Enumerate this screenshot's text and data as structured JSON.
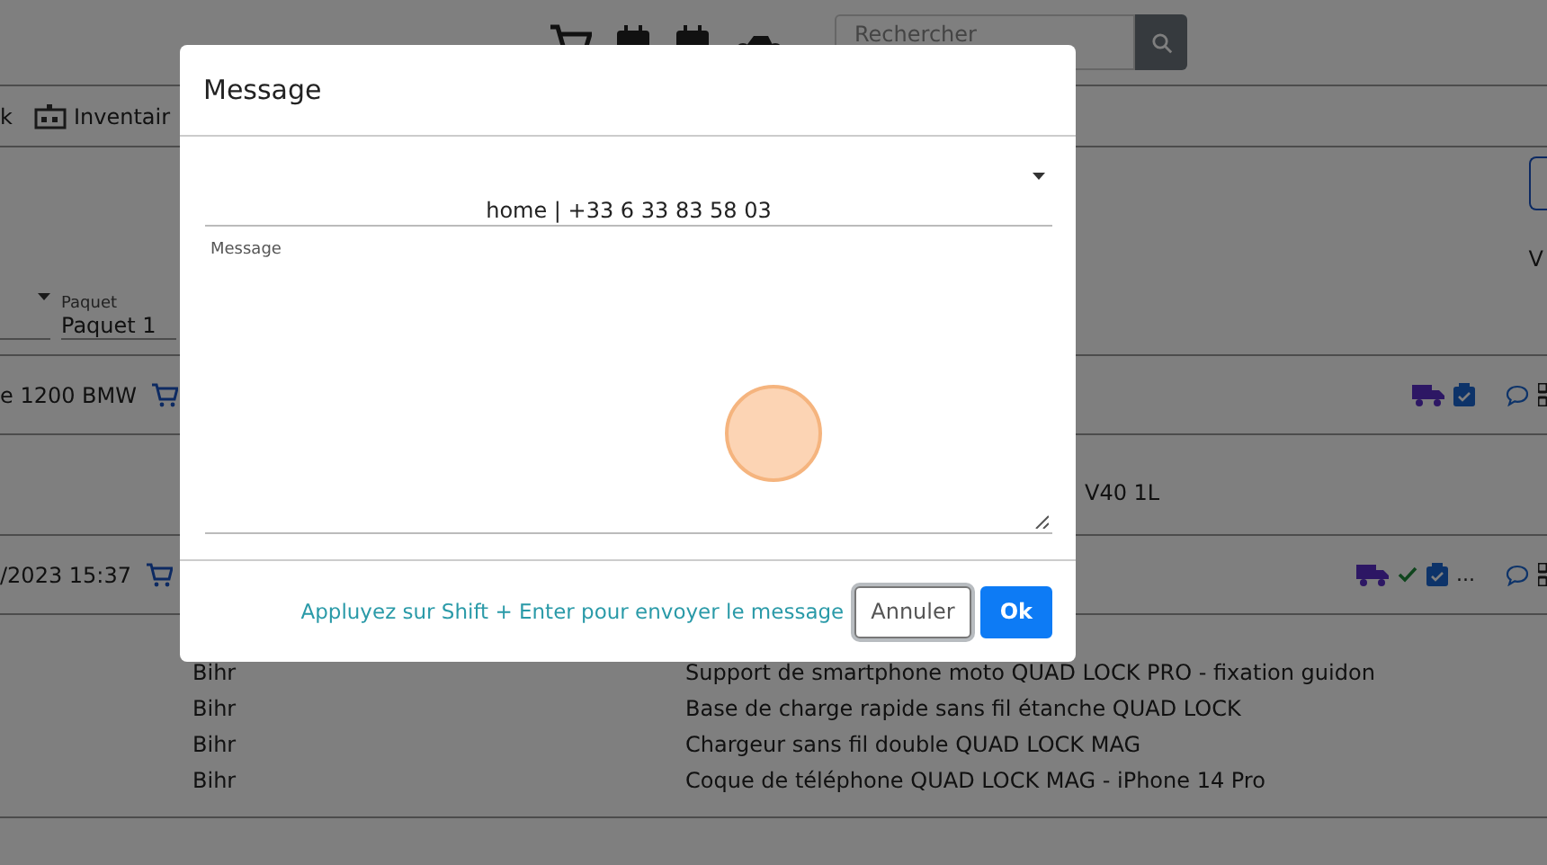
{
  "top_bar": {
    "search": {
      "placeholder": "Rechercher"
    }
  },
  "nav": [
    {
      "label": "k"
    },
    {
      "label": "Inventair"
    }
  ],
  "filters": {
    "package_label": "Paquet",
    "package_value": "Paquet 1",
    "view_label": "V"
  },
  "orders": [
    {
      "title": "e 1200 BMW",
      "statuses": [
        {
          "kind": "truck"
        },
        {
          "kind": "box"
        }
      ],
      "lines": [
        {
          "product": "V40 1L"
        }
      ]
    },
    {
      "title": "/2023 15:37",
      "statuses": [
        {
          "kind": "truck"
        },
        {
          "kind": "check"
        },
        {
          "kind": "box"
        },
        {
          "kind": "more",
          "text": "..."
        }
      ],
      "lines": [
        {
          "supplier": "Bihr",
          "product": "Support de smartphone moto QUAD LOCK PRO - fixation guidon"
        },
        {
          "supplier": "Bihr",
          "product": "Base de charge rapide sans fil étanche QUAD LOCK"
        },
        {
          "supplier": "Bihr",
          "product": "Chargeur sans fil double QUAD LOCK MAG"
        },
        {
          "supplier": "Bihr",
          "product": "Coque de téléphone QUAD LOCK MAG - iPhone 14 Pro"
        }
      ]
    }
  ],
  "modal": {
    "title": "Message",
    "recipient": "home | +33 6 33 83 58 03",
    "message_label": "Message",
    "hint": "Appluyez sur Shift + Enter pour envoyer le message",
    "buttons": [
      {
        "label": "Annuler",
        "kind": "secondary",
        "focused": true
      },
      {
        "label": "Ok",
        "kind": "primary",
        "focused": false
      }
    ]
  }
}
